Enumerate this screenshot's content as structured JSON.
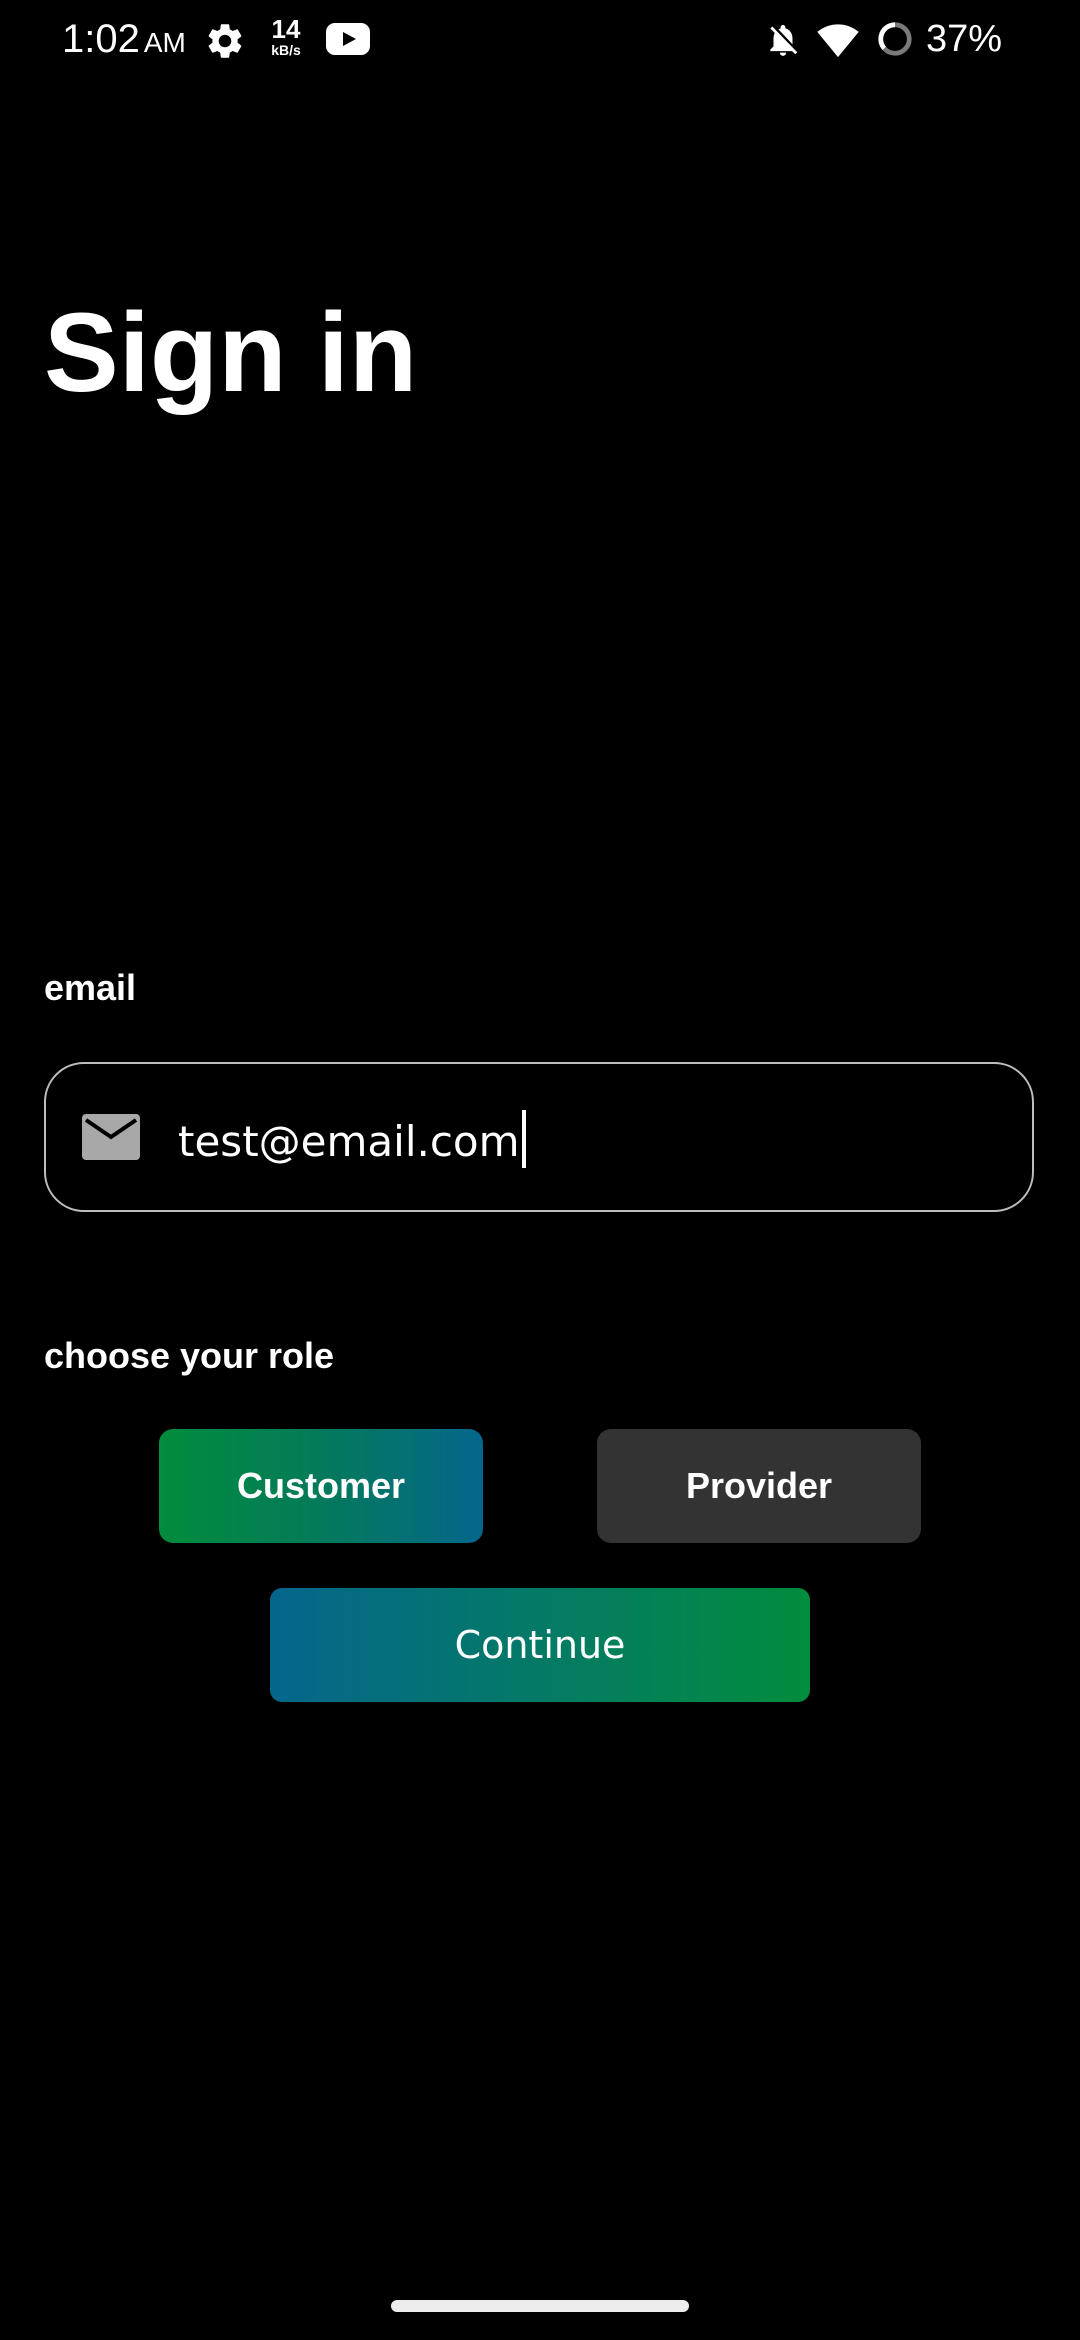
{
  "status_bar": {
    "time": "1:02",
    "ampm": "AM",
    "net_speed_value": "14",
    "net_speed_unit": "kB/s",
    "battery_percent": "37%",
    "icons": [
      "gear-icon",
      "youtube-icon",
      "bell-off-icon",
      "wifi-icon",
      "battery-saver-icon"
    ]
  },
  "page": {
    "title": "Sign in"
  },
  "email": {
    "label": "email",
    "value": "test@email.com",
    "icon": "mail-icon"
  },
  "role": {
    "label": "choose your role",
    "options": [
      "Customer",
      "Provider"
    ],
    "selected": "Customer"
  },
  "actions": {
    "continue_label": "Continue"
  },
  "colors": {
    "background": "#000000",
    "accent_green": "#028c3c",
    "accent_blue": "#05668c",
    "unselected_button": "#333333",
    "field_border": "#bdbdbd"
  }
}
